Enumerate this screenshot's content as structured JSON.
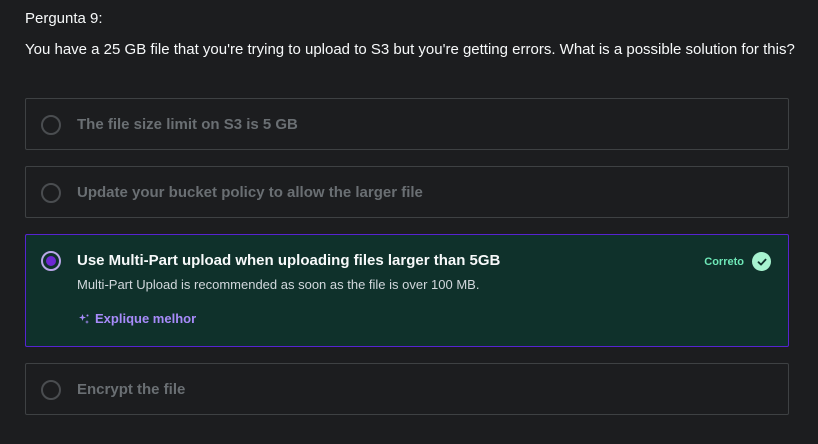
{
  "question": {
    "label": "Pergunta 9:",
    "text": "You have a 25 GB file that you're trying to upload to S3 but you're getting errors. What is a possible solution for this?"
  },
  "options": [
    {
      "label": "The file size limit on S3 is 5 GB",
      "selected": false
    },
    {
      "label": "Update your bucket policy to allow the larger file",
      "selected": false
    },
    {
      "label": "Use Multi-Part upload when uploading files larger than 5GB",
      "selected": true,
      "status": "Correto",
      "explanation": "Multi-Part Upload is recommended as soon as the file is over 100 MB.",
      "explain_more": "Explique melhor"
    },
    {
      "label": "Encrypt the file",
      "selected": false
    }
  ],
  "colors": {
    "background": "#1c1d1f",
    "correct_bg": "#0f312b",
    "correct_border": "#5624d0",
    "correct_text": "#6ee7b7",
    "accent_purple": "#a78bfa"
  }
}
